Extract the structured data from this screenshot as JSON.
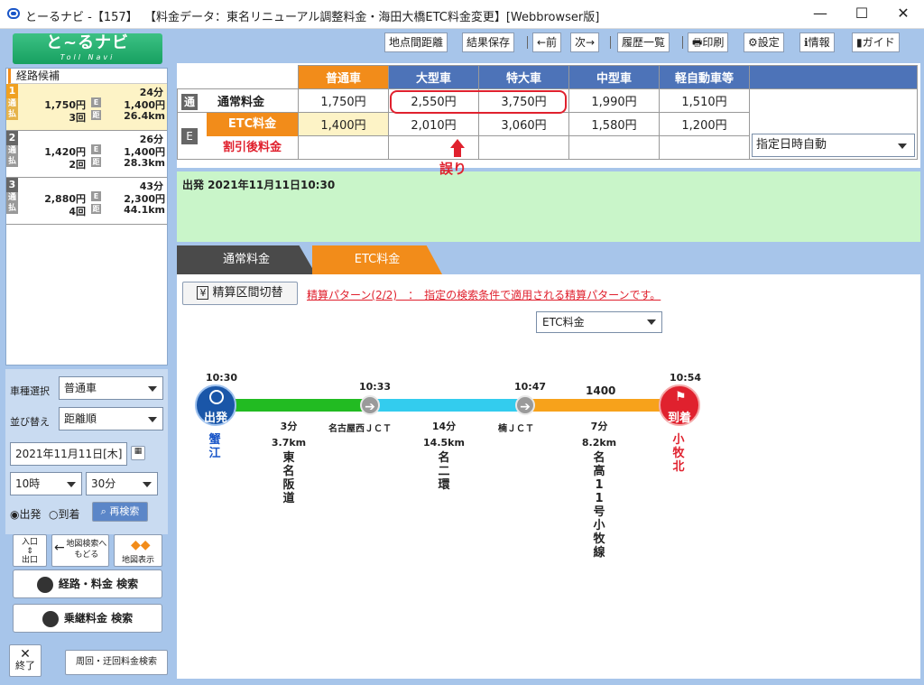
{
  "window": {
    "title": "とーるナビ -【157】",
    "subtitle": "【料金データ：東名リニューアル調整料金・海田大橋ETC料金変更】[Webbrowser版]",
    "minimize": "—",
    "maximize": "☐",
    "close": "✕"
  },
  "logo": {
    "main": "と~るナビ",
    "sub": "Toll Navi"
  },
  "routes_header": "経路候補",
  "routes": [
    {
      "num": "1",
      "time": "24分",
      "normal_fee": "1,750円",
      "etc_fee": "1,400円",
      "count": "3回",
      "distance": "26.4km",
      "side_labels": [
        "通",
        "払"
      ]
    },
    {
      "num": "2",
      "time": "26分",
      "normal_fee": "1,420円",
      "etc_fee": "1,400円",
      "count": "2回",
      "distance": "28.3km",
      "side_labels": [
        "通",
        "払"
      ]
    },
    {
      "num": "3",
      "time": "43分",
      "normal_fee": "2,880円",
      "etc_fee": "2,300円",
      "count": "4回",
      "distance": "44.1km",
      "side_labels": [
        "通",
        "払"
      ]
    }
  ],
  "search": {
    "vehicle_label": "車種選択",
    "vehicle_value": "普通車",
    "sort_label": "並び替え",
    "sort_value": "距離順",
    "date_value": "2021年11月11日[木]",
    "hour_value": "10時",
    "minute_value": "30分",
    "depart_radio": "◉出発",
    "arrive_radio": "○到着",
    "research_button": "再検索",
    "entry_exit": "入口\n⇕\n出口",
    "map_back": "地図検索へもどる",
    "map_show": "地図表示",
    "route_fee_search": "経路・料金 検索",
    "transfer_fee_search": "乗継料金 検索",
    "exit_button": "終了",
    "loop_search": "周回・迂回料金検索"
  },
  "toolbar": {
    "point_distance": "地点間距離",
    "save_result": "結果保存",
    "prev": "←前",
    "next": "次→",
    "history": "履歴一覧",
    "print": "印刷",
    "settings": "設定",
    "info": "情報",
    "guide": "ガイド"
  },
  "fee_table": {
    "headers": [
      "普通車",
      "大型車",
      "特大車",
      "中型車",
      "軽自動車等"
    ],
    "normal_mark": "通",
    "normal_label": "通常料金",
    "normal_values": [
      "1,750円",
      "2,550円",
      "3,750円",
      "1,990円",
      "1,510円"
    ],
    "etc_mark": "E",
    "etc_label": "ETC料金",
    "etc_values": [
      "1,400円",
      "2,010円",
      "3,060円",
      "1,580円",
      "1,200円"
    ],
    "discount_label": "割引後料金",
    "date_select": "指定日時自動"
  },
  "annotation": {
    "error_label": "誤り"
  },
  "depart_info": "出発 2021年11月11日10:30",
  "tabs": {
    "normal": "通常料金",
    "etc": "ETC料金"
  },
  "content": {
    "settle_button": "精算区間切替",
    "settle_icon": "¥",
    "pattern_text": "精算パターン(2/2)　：　指定の検索条件で適用される精算パターンです。",
    "etc_select": "ETC料金",
    "times": [
      "10:30",
      "10:33",
      "10:47",
      "10:54"
    ],
    "fee_marker": "1400",
    "start_label": "出発",
    "end_label": "到着",
    "start_place": "蟹江",
    "end_place": "小牧北",
    "nodes": [
      "名古屋西ＪＣＴ",
      "楠ＪＣＴ"
    ],
    "segments": [
      {
        "time": "3分",
        "distance": "3.7km",
        "road": "東名阪道"
      },
      {
        "time": "14分",
        "distance": "14.5km",
        "road": "名二環"
      },
      {
        "time": "7分",
        "distance": "8.2km",
        "road": "名高11号小牧線"
      }
    ]
  },
  "colors": {
    "accent_blue": "#4d73b8",
    "accent_orange": "#f28c1a",
    "error_red": "#e0212e",
    "seg_green": "#22bb22",
    "seg_cyan": "#33ccee",
    "seg_orange": "#f7a21b"
  }
}
